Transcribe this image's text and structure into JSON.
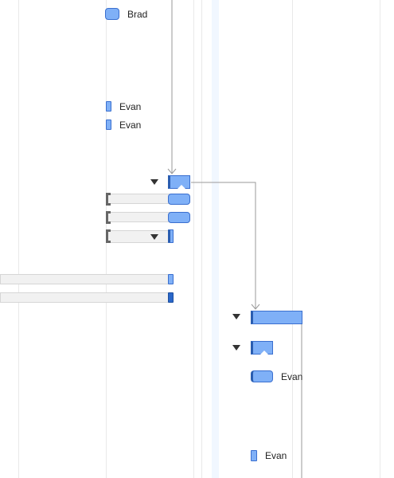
{
  "gantt": {
    "colors": {
      "task_bar": "#7fb0f7",
      "task_border": "#3a6fcf",
      "progress": "#2a5db0",
      "baseline": "#f1f1f1",
      "gridline": "#e9e9e9",
      "today_band": "#f1f7ff",
      "link": "#9a9a9a"
    },
    "icons": {
      "expand_toggle": "triangle-down-icon",
      "baseline_bracket": "bracket-icon",
      "link_arrow": "arrow-down-icon"
    },
    "resources": {
      "brad": "Brad",
      "evan_1": "Evan",
      "evan_2": "Evan",
      "evan_3": "Evan",
      "evan_4": "Evan"
    }
  }
}
